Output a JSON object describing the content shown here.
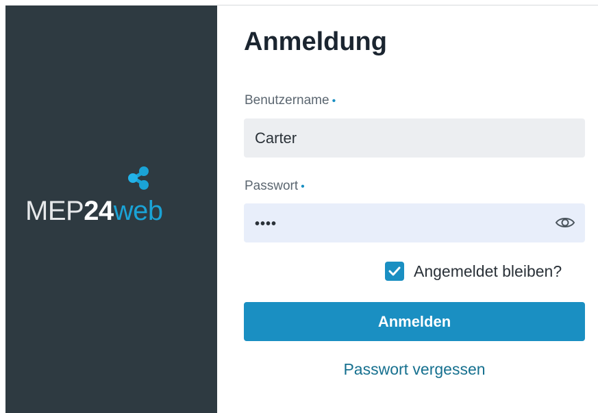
{
  "brand": {
    "part1": "MEP",
    "part2": "24",
    "part3": "web",
    "icon": "share-network-icon",
    "accent_color": "#1aa3d6",
    "panel_color": "#2e3a41"
  },
  "form": {
    "title": "Anmeldung",
    "username": {
      "label": "Benutzername",
      "required_marker": "•",
      "value": "Carter"
    },
    "password": {
      "label": "Passwort",
      "required_marker": "•",
      "value": "••••",
      "toggle_icon": "eye-icon"
    },
    "remember": {
      "label": "Angemeldet bleiben?",
      "checked": true,
      "icon": "checkmark-icon"
    },
    "submit_label": "Anmelden",
    "forgot_label": "Passwort vergessen",
    "primary_color": "#1a8fc2"
  }
}
